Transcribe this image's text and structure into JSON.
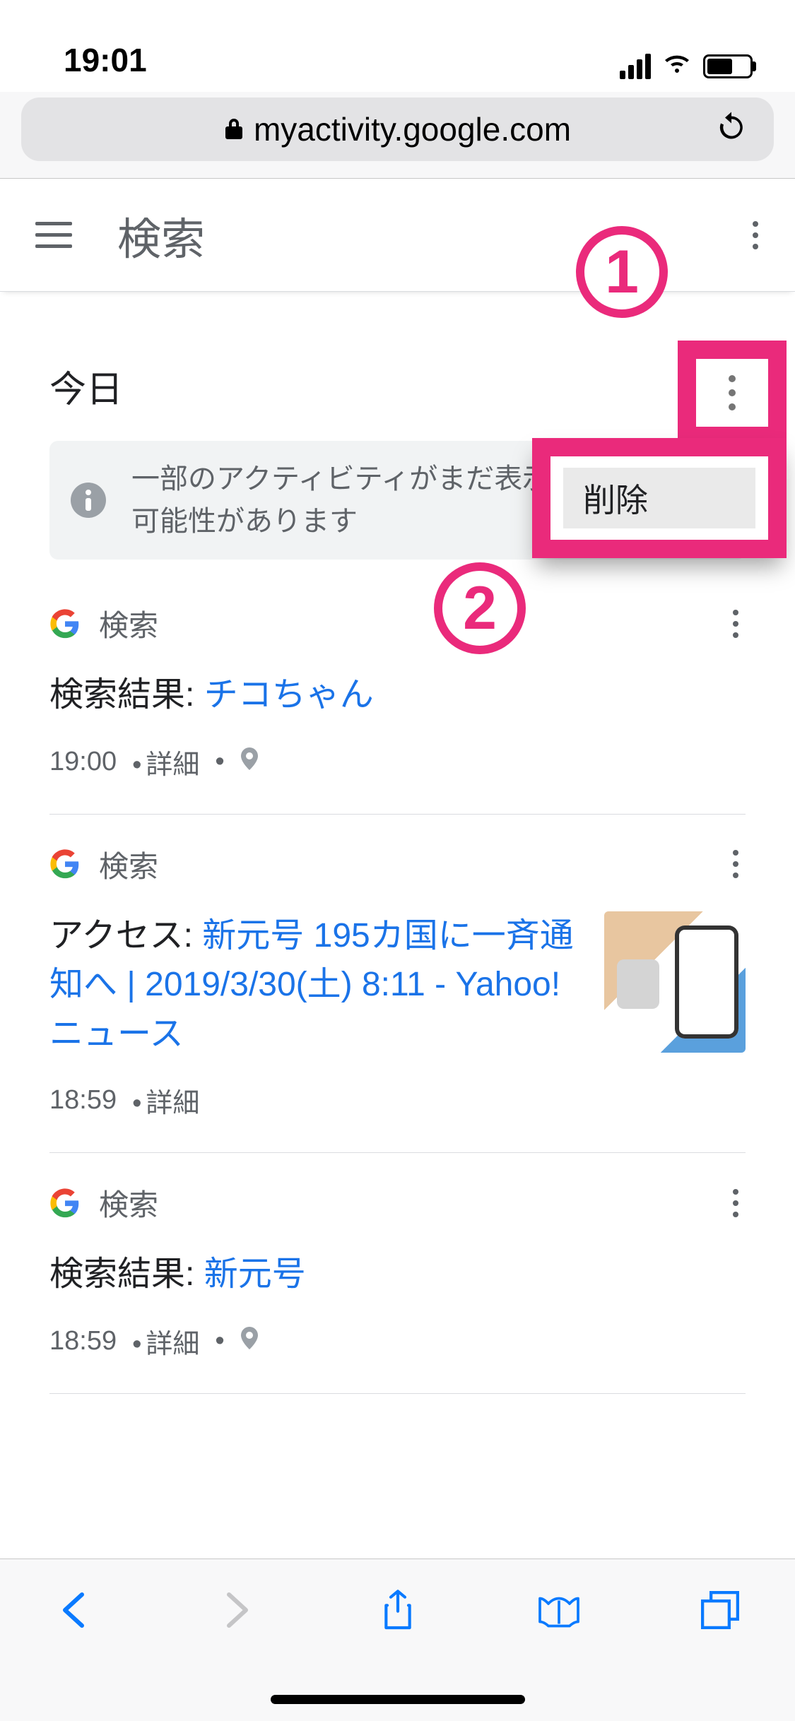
{
  "status": {
    "time": "19:01"
  },
  "safari": {
    "domain": "myactivity.google.com"
  },
  "header": {
    "title": "検索"
  },
  "section": {
    "today": "今日"
  },
  "banner": {
    "text": "一部のアクティビティがまだ表示されていない可能性があります"
  },
  "popup": {
    "delete": "削除"
  },
  "annotations": {
    "n1": "1",
    "n2": "2"
  },
  "cards": [
    {
      "source": "検索",
      "label": "検索結果: ",
      "link": "チコちゃん",
      "time": "19:00",
      "details": "詳細",
      "hasPin": true,
      "hasThumb": false
    },
    {
      "source": "検索",
      "label": "アクセス: ",
      "link": "新元号 195カ国に一斉通知へ | 2019/3/30(土) 8:11 - Yahoo!ニュース",
      "time": "18:59",
      "details": "詳細",
      "hasPin": false,
      "hasThumb": true
    },
    {
      "source": "検索",
      "label": "検索結果: ",
      "link": "新元号",
      "time": "18:59",
      "details": "詳細",
      "hasPin": true,
      "hasThumb": false
    }
  ]
}
